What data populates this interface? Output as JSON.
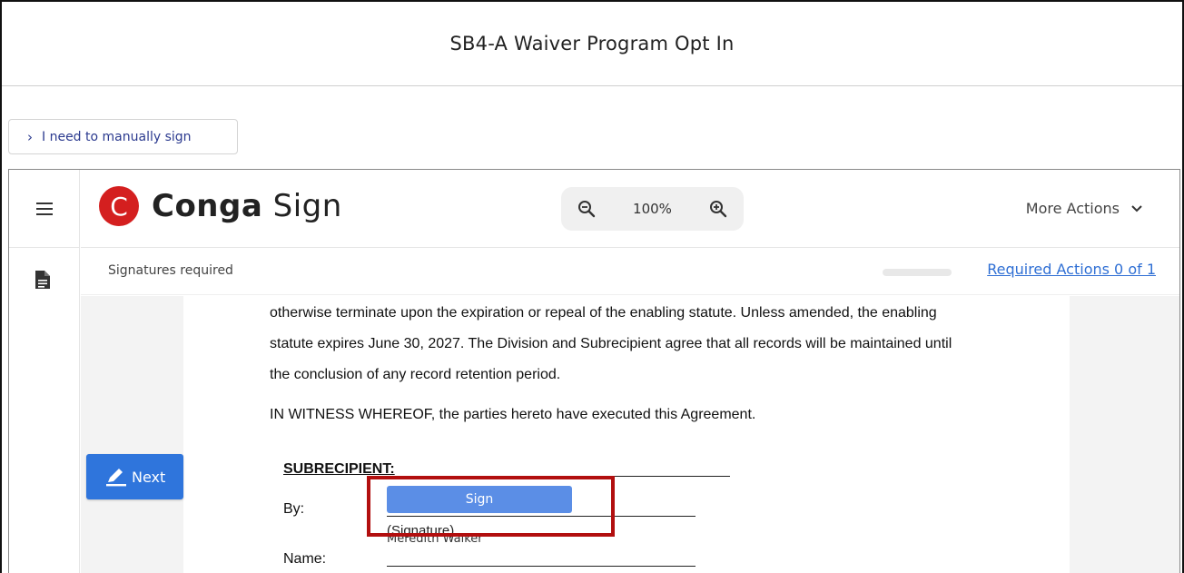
{
  "window": {
    "title": "SB4-A Waiver Program Opt In"
  },
  "manual_sign": {
    "label": "I need to manually sign"
  },
  "app": {
    "brand": {
      "logo_letter": "C",
      "name_bold": "Conga",
      "name_regular": "Sign"
    },
    "zoom": {
      "value": "100%"
    },
    "more_actions": {
      "label": "More Actions"
    },
    "status": {
      "label": "Signatures required",
      "required_actions": "Required Actions 0 of 1",
      "progress": 0
    },
    "next_button": {
      "label": "Next"
    }
  },
  "document": {
    "line1": "otherwise terminate upon the expiration or repeal of the enabling statute. Unless amended, the enabling",
    "line2": "statute expires June 30, 2027.  The Division and Subrecipient agree that all records will be maintained until",
    "line3": "the conclusion of any record retention period.",
    "line4": "IN WITNESS WHEREOF, the parties hereto have executed this Agreement.",
    "subrecipient_label": "SUBRECIPIENT:",
    "by_label": "By:",
    "sign_button": "Sign",
    "signature_caption": "(Signature)",
    "name_value": "Meredith Walker",
    "name_label": "Name:"
  },
  "colors": {
    "brand_red": "#d41f1f",
    "primary_blue": "#2f75dc",
    "sign_blue": "#5b8ee6",
    "link_blue": "#2f6fd4",
    "highlight_red": "#b20f0f"
  }
}
